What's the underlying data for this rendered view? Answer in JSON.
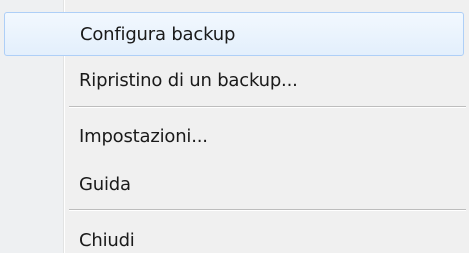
{
  "menu": {
    "items": [
      {
        "label": "Configura backup"
      },
      {
        "label": "Ripristino di un backup..."
      },
      {
        "label": "Impostazioni..."
      },
      {
        "label": "Guida"
      },
      {
        "label": "Chiudi"
      }
    ]
  }
}
